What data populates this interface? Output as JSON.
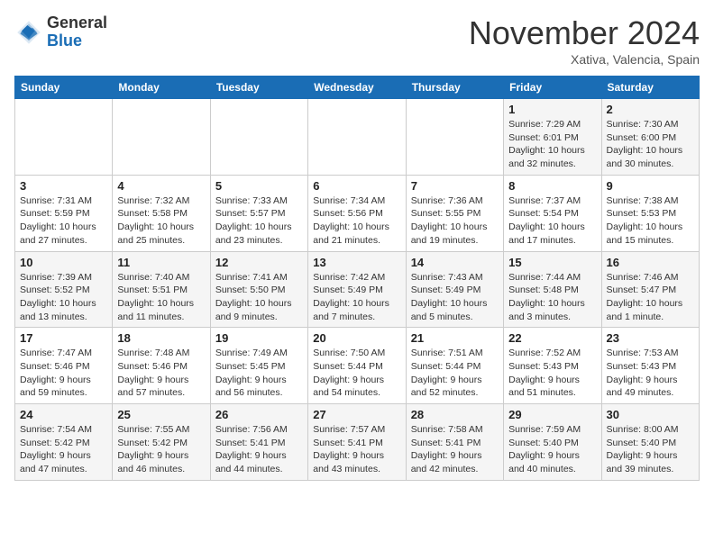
{
  "header": {
    "logo_general": "General",
    "logo_blue": "Blue",
    "month": "November 2024",
    "location": "Xativa, Valencia, Spain"
  },
  "weekdays": [
    "Sunday",
    "Monday",
    "Tuesday",
    "Wednesday",
    "Thursday",
    "Friday",
    "Saturday"
  ],
  "weeks": [
    [
      {
        "day": "",
        "info": ""
      },
      {
        "day": "",
        "info": ""
      },
      {
        "day": "",
        "info": ""
      },
      {
        "day": "",
        "info": ""
      },
      {
        "day": "",
        "info": ""
      },
      {
        "day": "1",
        "info": "Sunrise: 7:29 AM\nSunset: 6:01 PM\nDaylight: 10 hours and 32 minutes."
      },
      {
        "day": "2",
        "info": "Sunrise: 7:30 AM\nSunset: 6:00 PM\nDaylight: 10 hours and 30 minutes."
      }
    ],
    [
      {
        "day": "3",
        "info": "Sunrise: 7:31 AM\nSunset: 5:59 PM\nDaylight: 10 hours and 27 minutes."
      },
      {
        "day": "4",
        "info": "Sunrise: 7:32 AM\nSunset: 5:58 PM\nDaylight: 10 hours and 25 minutes."
      },
      {
        "day": "5",
        "info": "Sunrise: 7:33 AM\nSunset: 5:57 PM\nDaylight: 10 hours and 23 minutes."
      },
      {
        "day": "6",
        "info": "Sunrise: 7:34 AM\nSunset: 5:56 PM\nDaylight: 10 hours and 21 minutes."
      },
      {
        "day": "7",
        "info": "Sunrise: 7:36 AM\nSunset: 5:55 PM\nDaylight: 10 hours and 19 minutes."
      },
      {
        "day": "8",
        "info": "Sunrise: 7:37 AM\nSunset: 5:54 PM\nDaylight: 10 hours and 17 minutes."
      },
      {
        "day": "9",
        "info": "Sunrise: 7:38 AM\nSunset: 5:53 PM\nDaylight: 10 hours and 15 minutes."
      }
    ],
    [
      {
        "day": "10",
        "info": "Sunrise: 7:39 AM\nSunset: 5:52 PM\nDaylight: 10 hours and 13 minutes."
      },
      {
        "day": "11",
        "info": "Sunrise: 7:40 AM\nSunset: 5:51 PM\nDaylight: 10 hours and 11 minutes."
      },
      {
        "day": "12",
        "info": "Sunrise: 7:41 AM\nSunset: 5:50 PM\nDaylight: 10 hours and 9 minutes."
      },
      {
        "day": "13",
        "info": "Sunrise: 7:42 AM\nSunset: 5:49 PM\nDaylight: 10 hours and 7 minutes."
      },
      {
        "day": "14",
        "info": "Sunrise: 7:43 AM\nSunset: 5:49 PM\nDaylight: 10 hours and 5 minutes."
      },
      {
        "day": "15",
        "info": "Sunrise: 7:44 AM\nSunset: 5:48 PM\nDaylight: 10 hours and 3 minutes."
      },
      {
        "day": "16",
        "info": "Sunrise: 7:46 AM\nSunset: 5:47 PM\nDaylight: 10 hours and 1 minute."
      }
    ],
    [
      {
        "day": "17",
        "info": "Sunrise: 7:47 AM\nSunset: 5:46 PM\nDaylight: 9 hours and 59 minutes."
      },
      {
        "day": "18",
        "info": "Sunrise: 7:48 AM\nSunset: 5:46 PM\nDaylight: 9 hours and 57 minutes."
      },
      {
        "day": "19",
        "info": "Sunrise: 7:49 AM\nSunset: 5:45 PM\nDaylight: 9 hours and 56 minutes."
      },
      {
        "day": "20",
        "info": "Sunrise: 7:50 AM\nSunset: 5:44 PM\nDaylight: 9 hours and 54 minutes."
      },
      {
        "day": "21",
        "info": "Sunrise: 7:51 AM\nSunset: 5:44 PM\nDaylight: 9 hours and 52 minutes."
      },
      {
        "day": "22",
        "info": "Sunrise: 7:52 AM\nSunset: 5:43 PM\nDaylight: 9 hours and 51 minutes."
      },
      {
        "day": "23",
        "info": "Sunrise: 7:53 AM\nSunset: 5:43 PM\nDaylight: 9 hours and 49 minutes."
      }
    ],
    [
      {
        "day": "24",
        "info": "Sunrise: 7:54 AM\nSunset: 5:42 PM\nDaylight: 9 hours and 47 minutes."
      },
      {
        "day": "25",
        "info": "Sunrise: 7:55 AM\nSunset: 5:42 PM\nDaylight: 9 hours and 46 minutes."
      },
      {
        "day": "26",
        "info": "Sunrise: 7:56 AM\nSunset: 5:41 PM\nDaylight: 9 hours and 44 minutes."
      },
      {
        "day": "27",
        "info": "Sunrise: 7:57 AM\nSunset: 5:41 PM\nDaylight: 9 hours and 43 minutes."
      },
      {
        "day": "28",
        "info": "Sunrise: 7:58 AM\nSunset: 5:41 PM\nDaylight: 9 hours and 42 minutes."
      },
      {
        "day": "29",
        "info": "Sunrise: 7:59 AM\nSunset: 5:40 PM\nDaylight: 9 hours and 40 minutes."
      },
      {
        "day": "30",
        "info": "Sunrise: 8:00 AM\nSunset: 5:40 PM\nDaylight: 9 hours and 39 minutes."
      }
    ]
  ]
}
